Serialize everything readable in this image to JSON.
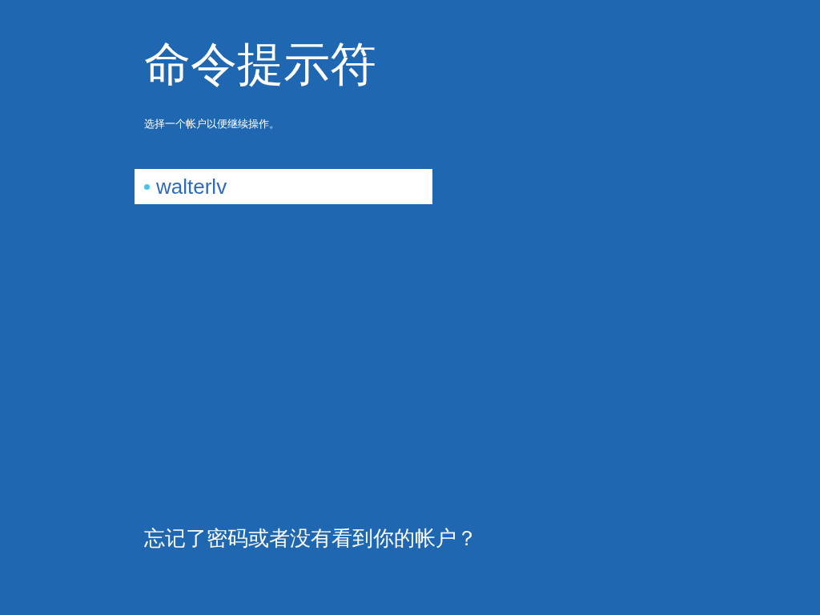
{
  "title": "命令提示符",
  "subtitle": "选择一个帐户以便继续操作。",
  "accounts": [
    {
      "name": "walterlv",
      "selected": true
    }
  ],
  "help_link": "忘记了密码或者没有看到你的帐户？"
}
